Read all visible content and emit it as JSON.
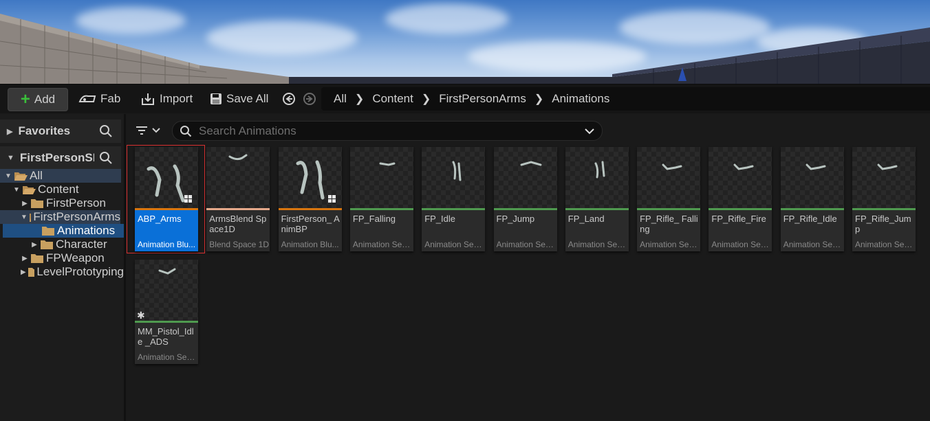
{
  "toolbar": {
    "add_label": "Add",
    "fab_label": "Fab",
    "import_label": "Import",
    "save_all_label": "Save All"
  },
  "breadcrumb": [
    "All",
    "Content",
    "FirstPersonArms",
    "Animations"
  ],
  "sidebar": {
    "favorites_label": "Favorites",
    "project_label": "FirstPersonSI",
    "tree": [
      {
        "label": "All"
      },
      {
        "label": "Content"
      },
      {
        "label": "FirstPerson"
      },
      {
        "label": "FirstPersonArms"
      },
      {
        "label": "Animations"
      },
      {
        "label": "Character"
      },
      {
        "label": "FPWeapon"
      },
      {
        "label": "LevelPrototyping"
      }
    ]
  },
  "search": {
    "placeholder": "Search Animations"
  },
  "assets": [
    {
      "name": "ABP_Arms",
      "type": "Animation Blueprint",
      "type_short": "Animation Blu...",
      "color": "#d9760f",
      "selected": true
    },
    {
      "name": "ArmsBlend Space1D",
      "type": "Blend Space 1D",
      "type_short": "Blend Space 1D",
      "color": "#e5a98b"
    },
    {
      "name": "FirstPerson_ AnimBP",
      "type": "Animation Blueprint",
      "type_short": "Animation Blu...",
      "color": "#d9760f"
    },
    {
      "name": "FP_Falling",
      "type": "Animation Sequence",
      "type_short": "Animation Seq...",
      "color": "#4f9a4f"
    },
    {
      "name": "FP_Idle",
      "type": "Animation Sequence",
      "type_short": "Animation Seq...",
      "color": "#4f9a4f"
    },
    {
      "name": "FP_Jump",
      "type": "Animation Sequence",
      "type_short": "Animation Seq...",
      "color": "#4f9a4f"
    },
    {
      "name": "FP_Land",
      "type": "Animation Sequence",
      "type_short": "Animation Seq...",
      "color": "#4f9a4f"
    },
    {
      "name": "FP_Rifle_ Falling",
      "type": "Animation Sequence",
      "type_short": "Animation Seq...",
      "color": "#4f9a4f"
    },
    {
      "name": "FP_Rifle_Fire",
      "type": "Animation Sequence",
      "type_short": "Animation Seq...",
      "color": "#4f9a4f"
    },
    {
      "name": "FP_Rifle_Idle",
      "type": "Animation Sequence",
      "type_short": "Animation Seq...",
      "color": "#4f9a4f"
    },
    {
      "name": "FP_Rifle_Jump",
      "type": "Animation Sequence",
      "type_short": "Animation Seq...",
      "color": "#4f9a4f"
    },
    {
      "name": "MM_Pistol_Idle _ADS",
      "type": "Animation Sequence",
      "type_short": "Animation Seq...",
      "color": "#4f9a4f"
    }
  ],
  "colors": {
    "accent": "#0a70d8",
    "folder": "#c8a060",
    "add_green": "#3bbf3b"
  }
}
